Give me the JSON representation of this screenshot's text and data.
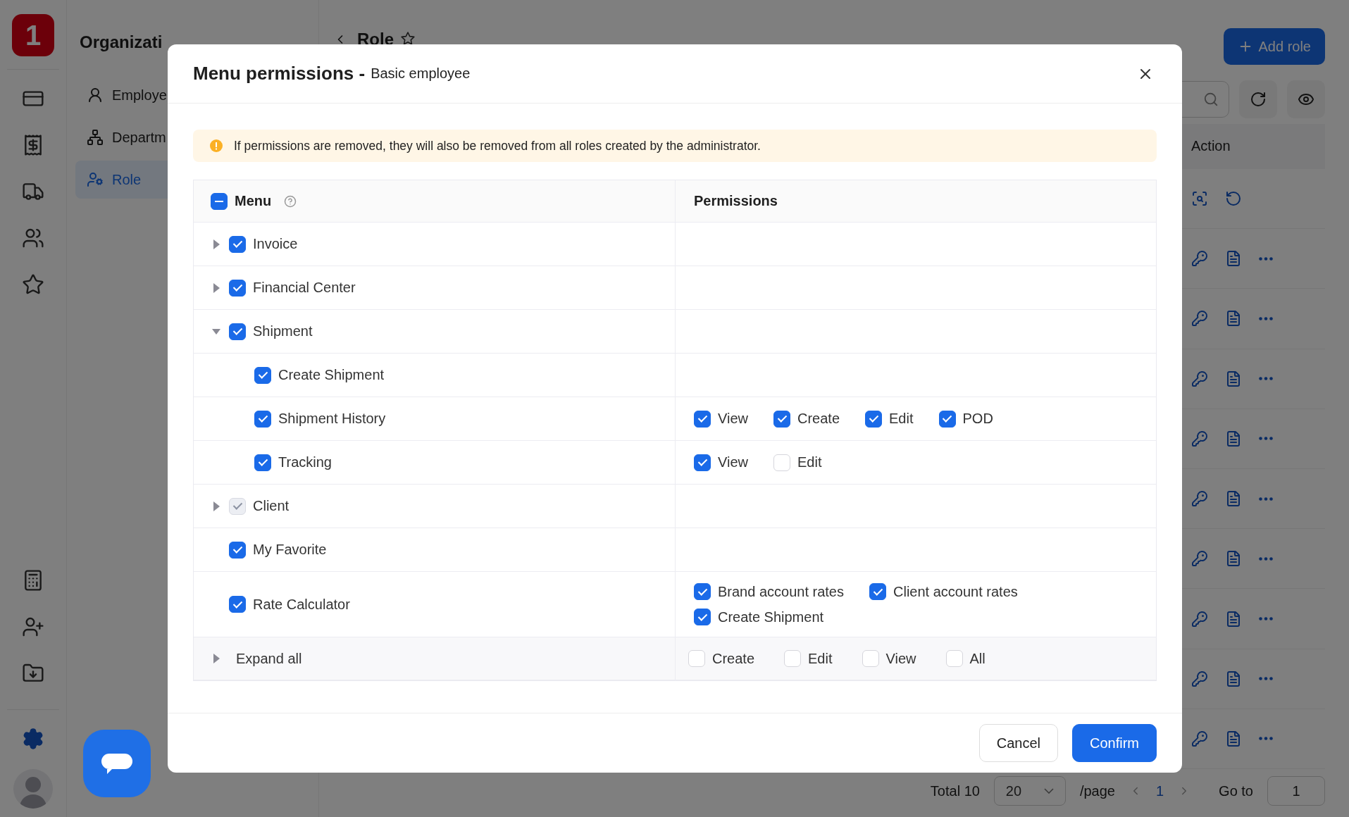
{
  "app": {
    "logo": "1",
    "section_title": "Organizati",
    "nav": [
      {
        "label": "Employe",
        "selected": false
      },
      {
        "label": "Departm",
        "selected": false
      },
      {
        "label": "Role",
        "selected": true
      }
    ],
    "page_title": "Role",
    "add_button": "Add role",
    "table": {
      "action_header": "Action",
      "rows": [
        {
          "kind": "system"
        },
        {
          "kind": "custom"
        },
        {
          "kind": "custom"
        },
        {
          "kind": "custom"
        },
        {
          "kind": "custom"
        },
        {
          "kind": "custom"
        },
        {
          "kind": "custom"
        },
        {
          "kind": "custom"
        },
        {
          "kind": "custom"
        },
        {
          "kind": "custom"
        }
      ]
    },
    "pagination": {
      "total": "Total 10",
      "page_size": "20",
      "per_page": "/page",
      "current": "1",
      "goto_label": "Go to",
      "goto_value": "1"
    }
  },
  "dialog": {
    "title": "Menu permissions -",
    "subtitle": "Basic employee",
    "alert": "If permissions are removed, they will also be removed from all roles created by the administrator.",
    "table": {
      "menu_header": "Menu",
      "header_checkbox": {
        "indeterminate": true
      },
      "permissions_header": "Permissions",
      "rows": [
        {
          "label": "Invoice",
          "checked": true,
          "disabled": false,
          "expanded": false
        },
        {
          "label": "Financial Center",
          "checked": true,
          "disabled": false,
          "expanded": false
        },
        {
          "label": "Shipment",
          "checked": true,
          "disabled": false,
          "expanded": true,
          "children": [
            {
              "label": "Create Shipment",
              "checked": true,
              "disabled": false
            },
            {
              "label": "Shipment History",
              "checked": true,
              "disabled": false,
              "permissions": [
                {
                  "label": "View",
                  "checked": true
                },
                {
                  "label": "Create",
                  "checked": true
                },
                {
                  "label": "Edit",
                  "checked": true
                },
                {
                  "label": "POD",
                  "checked": true
                }
              ]
            },
            {
              "label": "Tracking",
              "checked": true,
              "disabled": false,
              "permissions": [
                {
                  "label": "View",
                  "checked": true
                },
                {
                  "label": "Edit",
                  "checked": false
                }
              ]
            }
          ]
        },
        {
          "label": "Client",
          "checked": true,
          "disabled": true,
          "expanded": false
        },
        {
          "label": "My Favorite",
          "checked": true,
          "disabled": false
        },
        {
          "label": "Rate Calculator",
          "checked": true,
          "disabled": false,
          "permissions": [
            {
              "label": "Brand account rates",
              "checked": true
            },
            {
              "label": "Client account rates",
              "checked": true
            },
            {
              "label": "Create Shipment",
              "checked": true
            }
          ]
        }
      ],
      "footer": {
        "label": "Expand all",
        "expanded": false,
        "options": [
          {
            "label": "Create",
            "checked": false
          },
          {
            "label": "Edit",
            "checked": false
          },
          {
            "label": "View",
            "checked": false
          },
          {
            "label": "All",
            "checked": false
          }
        ]
      }
    },
    "buttons": [
      {
        "label": "Cancel",
        "kind": "secondary"
      },
      {
        "label": "Confirm",
        "kind": "primary"
      }
    ]
  }
}
